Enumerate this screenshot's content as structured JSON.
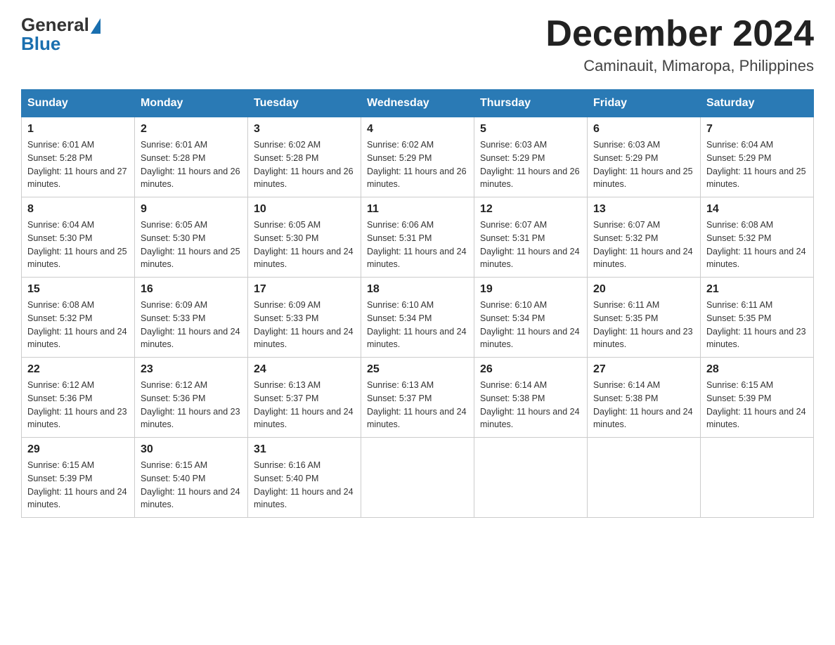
{
  "logo": {
    "general": "General",
    "blue": "Blue"
  },
  "header": {
    "month_year": "December 2024",
    "location": "Caminauit, Mimaropa, Philippines"
  },
  "days_of_week": [
    "Sunday",
    "Monday",
    "Tuesday",
    "Wednesday",
    "Thursday",
    "Friday",
    "Saturday"
  ],
  "weeks": [
    [
      {
        "day": "1",
        "sunrise": "Sunrise: 6:01 AM",
        "sunset": "Sunset: 5:28 PM",
        "daylight": "Daylight: 11 hours and 27 minutes."
      },
      {
        "day": "2",
        "sunrise": "Sunrise: 6:01 AM",
        "sunset": "Sunset: 5:28 PM",
        "daylight": "Daylight: 11 hours and 26 minutes."
      },
      {
        "day": "3",
        "sunrise": "Sunrise: 6:02 AM",
        "sunset": "Sunset: 5:28 PM",
        "daylight": "Daylight: 11 hours and 26 minutes."
      },
      {
        "day": "4",
        "sunrise": "Sunrise: 6:02 AM",
        "sunset": "Sunset: 5:29 PM",
        "daylight": "Daylight: 11 hours and 26 minutes."
      },
      {
        "day": "5",
        "sunrise": "Sunrise: 6:03 AM",
        "sunset": "Sunset: 5:29 PM",
        "daylight": "Daylight: 11 hours and 26 minutes."
      },
      {
        "day": "6",
        "sunrise": "Sunrise: 6:03 AM",
        "sunset": "Sunset: 5:29 PM",
        "daylight": "Daylight: 11 hours and 25 minutes."
      },
      {
        "day": "7",
        "sunrise": "Sunrise: 6:04 AM",
        "sunset": "Sunset: 5:29 PM",
        "daylight": "Daylight: 11 hours and 25 minutes."
      }
    ],
    [
      {
        "day": "8",
        "sunrise": "Sunrise: 6:04 AM",
        "sunset": "Sunset: 5:30 PM",
        "daylight": "Daylight: 11 hours and 25 minutes."
      },
      {
        "day": "9",
        "sunrise": "Sunrise: 6:05 AM",
        "sunset": "Sunset: 5:30 PM",
        "daylight": "Daylight: 11 hours and 25 minutes."
      },
      {
        "day": "10",
        "sunrise": "Sunrise: 6:05 AM",
        "sunset": "Sunset: 5:30 PM",
        "daylight": "Daylight: 11 hours and 24 minutes."
      },
      {
        "day": "11",
        "sunrise": "Sunrise: 6:06 AM",
        "sunset": "Sunset: 5:31 PM",
        "daylight": "Daylight: 11 hours and 24 minutes."
      },
      {
        "day": "12",
        "sunrise": "Sunrise: 6:07 AM",
        "sunset": "Sunset: 5:31 PM",
        "daylight": "Daylight: 11 hours and 24 minutes."
      },
      {
        "day": "13",
        "sunrise": "Sunrise: 6:07 AM",
        "sunset": "Sunset: 5:32 PM",
        "daylight": "Daylight: 11 hours and 24 minutes."
      },
      {
        "day": "14",
        "sunrise": "Sunrise: 6:08 AM",
        "sunset": "Sunset: 5:32 PM",
        "daylight": "Daylight: 11 hours and 24 minutes."
      }
    ],
    [
      {
        "day": "15",
        "sunrise": "Sunrise: 6:08 AM",
        "sunset": "Sunset: 5:32 PM",
        "daylight": "Daylight: 11 hours and 24 minutes."
      },
      {
        "day": "16",
        "sunrise": "Sunrise: 6:09 AM",
        "sunset": "Sunset: 5:33 PM",
        "daylight": "Daylight: 11 hours and 24 minutes."
      },
      {
        "day": "17",
        "sunrise": "Sunrise: 6:09 AM",
        "sunset": "Sunset: 5:33 PM",
        "daylight": "Daylight: 11 hours and 24 minutes."
      },
      {
        "day": "18",
        "sunrise": "Sunrise: 6:10 AM",
        "sunset": "Sunset: 5:34 PM",
        "daylight": "Daylight: 11 hours and 24 minutes."
      },
      {
        "day": "19",
        "sunrise": "Sunrise: 6:10 AM",
        "sunset": "Sunset: 5:34 PM",
        "daylight": "Daylight: 11 hours and 24 minutes."
      },
      {
        "day": "20",
        "sunrise": "Sunrise: 6:11 AM",
        "sunset": "Sunset: 5:35 PM",
        "daylight": "Daylight: 11 hours and 23 minutes."
      },
      {
        "day": "21",
        "sunrise": "Sunrise: 6:11 AM",
        "sunset": "Sunset: 5:35 PM",
        "daylight": "Daylight: 11 hours and 23 minutes."
      }
    ],
    [
      {
        "day": "22",
        "sunrise": "Sunrise: 6:12 AM",
        "sunset": "Sunset: 5:36 PM",
        "daylight": "Daylight: 11 hours and 23 minutes."
      },
      {
        "day": "23",
        "sunrise": "Sunrise: 6:12 AM",
        "sunset": "Sunset: 5:36 PM",
        "daylight": "Daylight: 11 hours and 23 minutes."
      },
      {
        "day": "24",
        "sunrise": "Sunrise: 6:13 AM",
        "sunset": "Sunset: 5:37 PM",
        "daylight": "Daylight: 11 hours and 24 minutes."
      },
      {
        "day": "25",
        "sunrise": "Sunrise: 6:13 AM",
        "sunset": "Sunset: 5:37 PM",
        "daylight": "Daylight: 11 hours and 24 minutes."
      },
      {
        "day": "26",
        "sunrise": "Sunrise: 6:14 AM",
        "sunset": "Sunset: 5:38 PM",
        "daylight": "Daylight: 11 hours and 24 minutes."
      },
      {
        "day": "27",
        "sunrise": "Sunrise: 6:14 AM",
        "sunset": "Sunset: 5:38 PM",
        "daylight": "Daylight: 11 hours and 24 minutes."
      },
      {
        "day": "28",
        "sunrise": "Sunrise: 6:15 AM",
        "sunset": "Sunset: 5:39 PM",
        "daylight": "Daylight: 11 hours and 24 minutes."
      }
    ],
    [
      {
        "day": "29",
        "sunrise": "Sunrise: 6:15 AM",
        "sunset": "Sunset: 5:39 PM",
        "daylight": "Daylight: 11 hours and 24 minutes."
      },
      {
        "day": "30",
        "sunrise": "Sunrise: 6:15 AM",
        "sunset": "Sunset: 5:40 PM",
        "daylight": "Daylight: 11 hours and 24 minutes."
      },
      {
        "day": "31",
        "sunrise": "Sunrise: 6:16 AM",
        "sunset": "Sunset: 5:40 PM",
        "daylight": "Daylight: 11 hours and 24 minutes."
      },
      null,
      null,
      null,
      null
    ]
  ]
}
